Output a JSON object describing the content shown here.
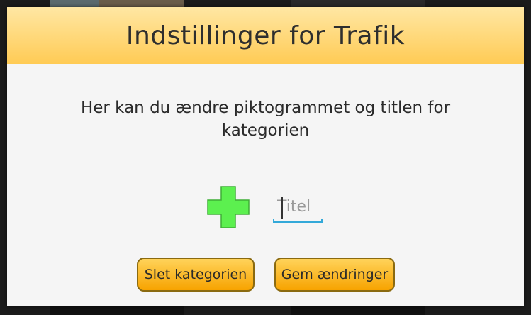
{
  "dialog": {
    "title": "Indstillinger for Trafik",
    "message": "Her kan du ændre piktogrammet og titlen for kategorien",
    "title_input": {
      "value": "",
      "placeholder": "Titel"
    },
    "pictogram_icon": "plus-icon",
    "buttons": {
      "delete_label": "Slet kategorien",
      "save_label": "Gem ændringer"
    }
  },
  "colors": {
    "header_top": "#ffe7a3",
    "header_bottom": "#ffcb55",
    "button_top": "#ffd35a",
    "button_bottom": "#f7a300",
    "pictogram_fill": "#5cf04f",
    "input_accent": "#33a9d9"
  }
}
